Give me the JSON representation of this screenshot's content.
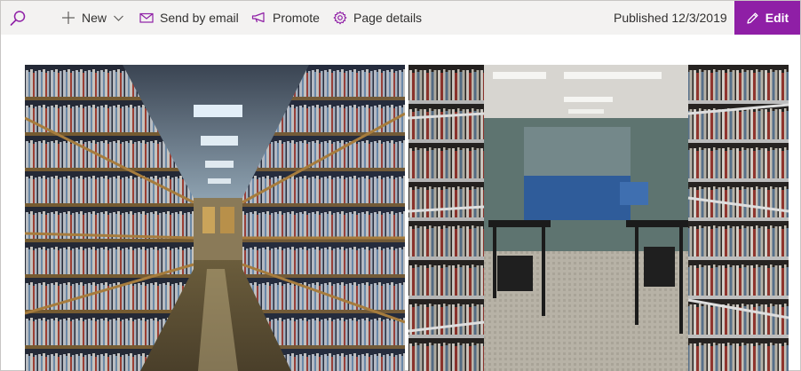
{
  "toolbar": {
    "new_label": "New",
    "send_email_label": "Send by email",
    "promote_label": "Promote",
    "page_details_label": "Page details",
    "published_text": "Published 12/3/2019",
    "edit_label": "Edit"
  },
  "icons": {
    "search": "search-icon",
    "new": "plus-icon",
    "new_dropdown": "chevron-down-icon",
    "email": "mail-icon",
    "promote": "megaphone-icon",
    "details": "gear-icon",
    "edit": "pencil-icon"
  },
  "colors": {
    "toolbar_bg": "#f3f2f1",
    "accent": "#8f1fa6",
    "icon": "#8f1fa6",
    "text": "#323130"
  },
  "images": [
    {
      "subject": "library-aisle-with-bookshelves"
    },
    {
      "subject": "library-bookshelves-facing-study-area"
    }
  ]
}
